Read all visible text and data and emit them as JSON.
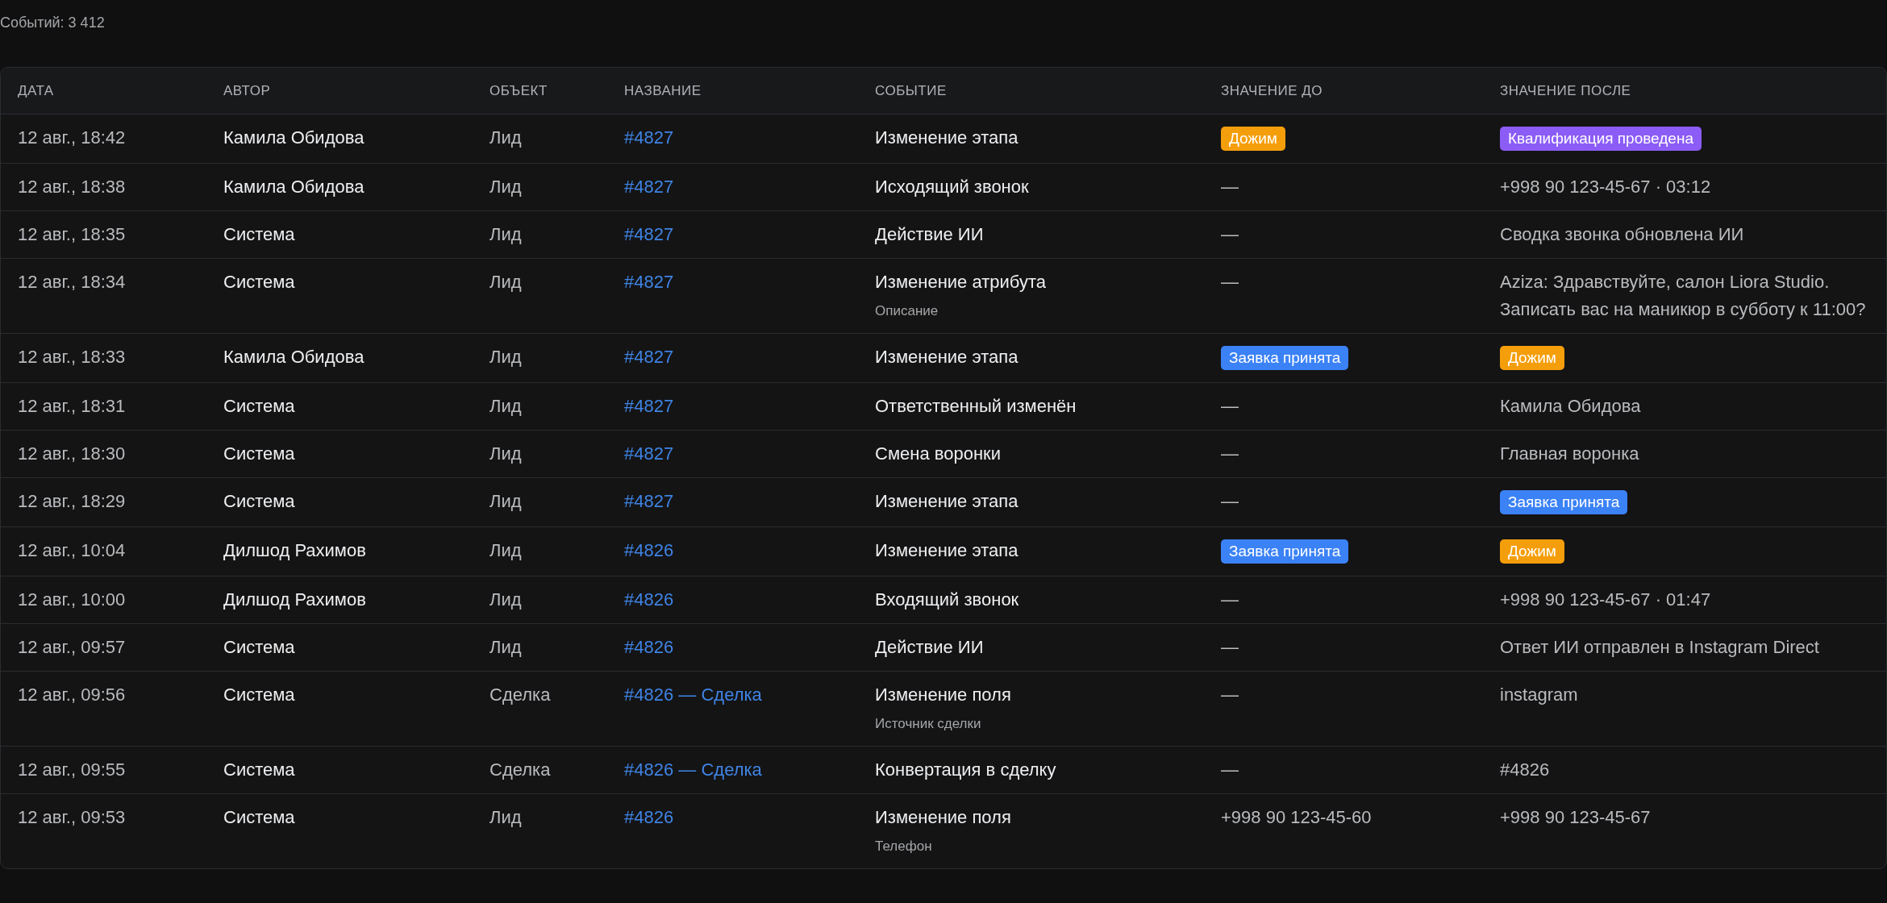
{
  "summary": "Событий: 3 412",
  "table": {
    "columns": [
      "ДАТА",
      "АВТОР",
      "ОБЪЕКТ",
      "НАЗВАНИЕ",
      "СОБЫТИЕ",
      "ЗНАЧЕНИЕ ДО",
      "ЗНАЧЕНИЕ ПОСЛЕ"
    ],
    "rows": [
      {
        "date": "12 авг., 18:42",
        "author": "Камила Обидова",
        "object": "Лид",
        "name": "#4827",
        "event": "Изменение этапа",
        "before": {
          "kind": "badge",
          "text": "Дожим",
          "color": "#f59e0b"
        },
        "after": {
          "kind": "badge",
          "text": "Квалификация проведена",
          "color": "#8b5cf6"
        }
      },
      {
        "date": "12 авг., 18:38",
        "author": "Камила Обидова",
        "object": "Лид",
        "name": "#4827",
        "event": "Исходящий звонок",
        "before": {
          "kind": "text",
          "text": "—"
        },
        "after": {
          "kind": "text",
          "text": "+998 90 123-45-67 · 03:12"
        }
      },
      {
        "date": "12 авг., 18:35",
        "author": "Система",
        "object": "Лид",
        "name": "#4827",
        "event": "Действие ИИ",
        "before": {
          "kind": "text",
          "text": "—"
        },
        "after": {
          "kind": "text",
          "text": "Сводка звонка обновлена ИИ"
        }
      },
      {
        "date": "12 авг., 18:34",
        "author": "Система",
        "object": "Лид",
        "name": "#4827",
        "event": "Изменение атрибута",
        "detail": "Описание",
        "before": {
          "kind": "text",
          "text": "—"
        },
        "after": {
          "kind": "text",
          "text": "Aziza: Здравствуйте, салон Liora Studio. Записать вас на маникюр в субботу к 11:00?"
        }
      },
      {
        "date": "12 авг., 18:33",
        "author": "Камила Обидова",
        "object": "Лид",
        "name": "#4827",
        "event": "Изменение этапа",
        "before": {
          "kind": "badge",
          "text": "Заявка принята",
          "color": "#3b82f6"
        },
        "after": {
          "kind": "badge",
          "text": "Дожим",
          "color": "#f59e0b"
        }
      },
      {
        "date": "12 авг., 18:31",
        "author": "Система",
        "object": "Лид",
        "name": "#4827",
        "event": "Ответственный изменён",
        "before": {
          "kind": "text",
          "text": "—"
        },
        "after": {
          "kind": "text",
          "text": "Камила Обидова"
        }
      },
      {
        "date": "12 авг., 18:30",
        "author": "Система",
        "object": "Лид",
        "name": "#4827",
        "event": "Смена воронки",
        "before": {
          "kind": "text",
          "text": "—"
        },
        "after": {
          "kind": "text",
          "text": "Главная воронка"
        }
      },
      {
        "date": "12 авг., 18:29",
        "author": "Система",
        "object": "Лид",
        "name": "#4827",
        "event": "Изменение этапа",
        "before": {
          "kind": "text",
          "text": "—"
        },
        "after": {
          "kind": "badge",
          "text": "Заявка принята",
          "color": "#3b82f6"
        }
      },
      {
        "date": "12 авг., 10:04",
        "author": "Дилшод Рахимов",
        "object": "Лид",
        "name": "#4826",
        "event": "Изменение этапа",
        "before": {
          "kind": "badge",
          "text": "Заявка принята",
          "color": "#3b82f6"
        },
        "after": {
          "kind": "badge",
          "text": "Дожим",
          "color": "#f59e0b"
        }
      },
      {
        "date": "12 авг., 10:00",
        "author": "Дилшод Рахимов",
        "object": "Лид",
        "name": "#4826",
        "event": "Входящий звонок",
        "before": {
          "kind": "text",
          "text": "—"
        },
        "after": {
          "kind": "text",
          "text": "+998 90 123-45-67 · 01:47"
        }
      },
      {
        "date": "12 авг., 09:57",
        "author": "Система",
        "object": "Лид",
        "name": "#4826",
        "event": "Действие ИИ",
        "before": {
          "kind": "text",
          "text": "—"
        },
        "after": {
          "kind": "text",
          "text": "Ответ ИИ отправлен в Instagram Direct"
        }
      },
      {
        "date": "12 авг., 09:56",
        "author": "Система",
        "object": "Сделка",
        "name": "#4826 — Сделка",
        "event": "Изменение поля",
        "detail": "Источник сделки",
        "before": {
          "kind": "text",
          "text": "—"
        },
        "after": {
          "kind": "text",
          "text": "instagram"
        }
      },
      {
        "date": "12 авг., 09:55",
        "author": "Система",
        "object": "Сделка",
        "name": "#4826 — Сделка",
        "event": "Конвертация в сделку",
        "before": {
          "kind": "text",
          "text": "—"
        },
        "after": {
          "kind": "text",
          "text": "#4826"
        }
      },
      {
        "date": "12 авг., 09:53",
        "author": "Система",
        "object": "Лид",
        "name": "#4826",
        "event": "Изменение поля",
        "detail": "Телефон",
        "before": {
          "kind": "text",
          "text": "+998 90 123-45-60"
        },
        "after": {
          "kind": "text",
          "text": "+998 90 123-45-67"
        }
      }
    ]
  }
}
